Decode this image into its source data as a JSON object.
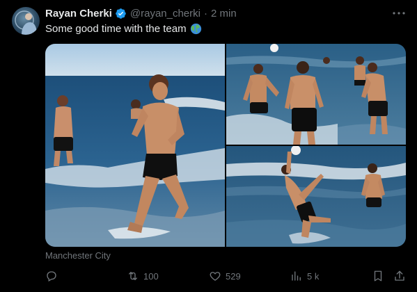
{
  "tweet": {
    "author": {
      "display_name": "Rayan Cherki",
      "handle": "@rayan_cherki",
      "verified": true,
      "avatar": "avatar-image"
    },
    "time_separator": "·",
    "timestamp": "2 min",
    "text": "Some good time with the team",
    "emoji": "globe-icon",
    "media": [
      {
        "description": "player-running-out-of-sea-photo"
      },
      {
        "description": "players-in-sea-with-ball-photo"
      },
      {
        "description": "player-kicking-ball-in-sea-photo"
      }
    ],
    "media_source": "Manchester City",
    "actions": {
      "reply": {
        "icon": "reply-icon",
        "count": ""
      },
      "retweet": {
        "icon": "retweet-icon",
        "count": "100"
      },
      "like": {
        "icon": "heart-icon",
        "count": "529"
      },
      "views": {
        "icon": "views-icon",
        "count": "5 k"
      },
      "bookmark": {
        "icon": "bookmark-icon"
      },
      "share": {
        "icon": "share-icon"
      }
    },
    "colors": {
      "background": "#000000",
      "text": "#e7e9ea",
      "muted": "#71767b",
      "verified_badge": "#1d9bf0"
    }
  }
}
